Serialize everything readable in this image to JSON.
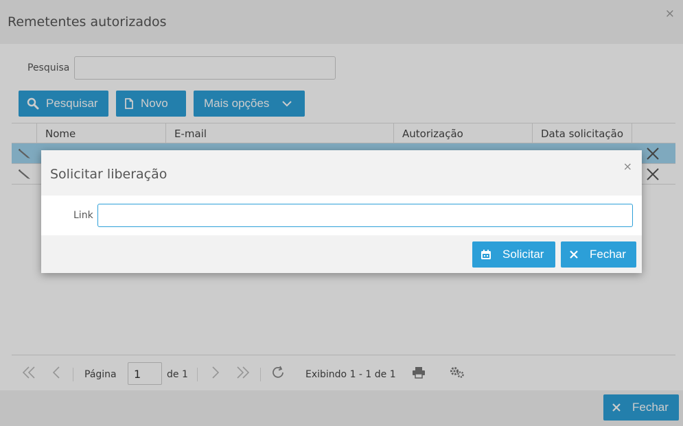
{
  "window": {
    "title": "Remetentes autorizados",
    "close_glyph": "×",
    "search_label": "Pesquisa",
    "search_value": ""
  },
  "toolbar": {
    "search_label": "Pesquisar",
    "new_label": "Novo",
    "more_label": "Mais opções"
  },
  "grid": {
    "columns": [
      "Nome",
      "E-mail",
      "Autorização",
      "Data solicitação"
    ],
    "rows": [
      {
        "selected": true
      },
      {
        "selected": false
      }
    ]
  },
  "pager": {
    "page_label": "Página",
    "page_value": "1",
    "of_label": "de 1",
    "status": "Exibindo 1 - 1 de 1"
  },
  "footer": {
    "close_label": "Fechar"
  },
  "modal": {
    "title": "Solicitar liberação",
    "close_glyph": "×",
    "link_label": "Link",
    "link_value": "",
    "request_label": "Solicitar",
    "close_label": "Fechar"
  },
  "colors": {
    "accent": "#2c9fd8",
    "selected_row": "#9fd4ee",
    "header_bg": "#f2f2f2"
  },
  "icons": {
    "search": "search-icon",
    "new": "document-icon",
    "more": "chevron-down-icon",
    "edit": "pencil-icon",
    "delete": "close-icon",
    "first": "double-chevron-left-icon",
    "prev": "chevron-left-icon",
    "next": "chevron-right-icon",
    "last": "double-chevron-right-icon",
    "refresh": "refresh-icon",
    "print": "printer-icon",
    "settings": "gears-icon",
    "request": "calendar-icon",
    "close": "close-icon"
  }
}
